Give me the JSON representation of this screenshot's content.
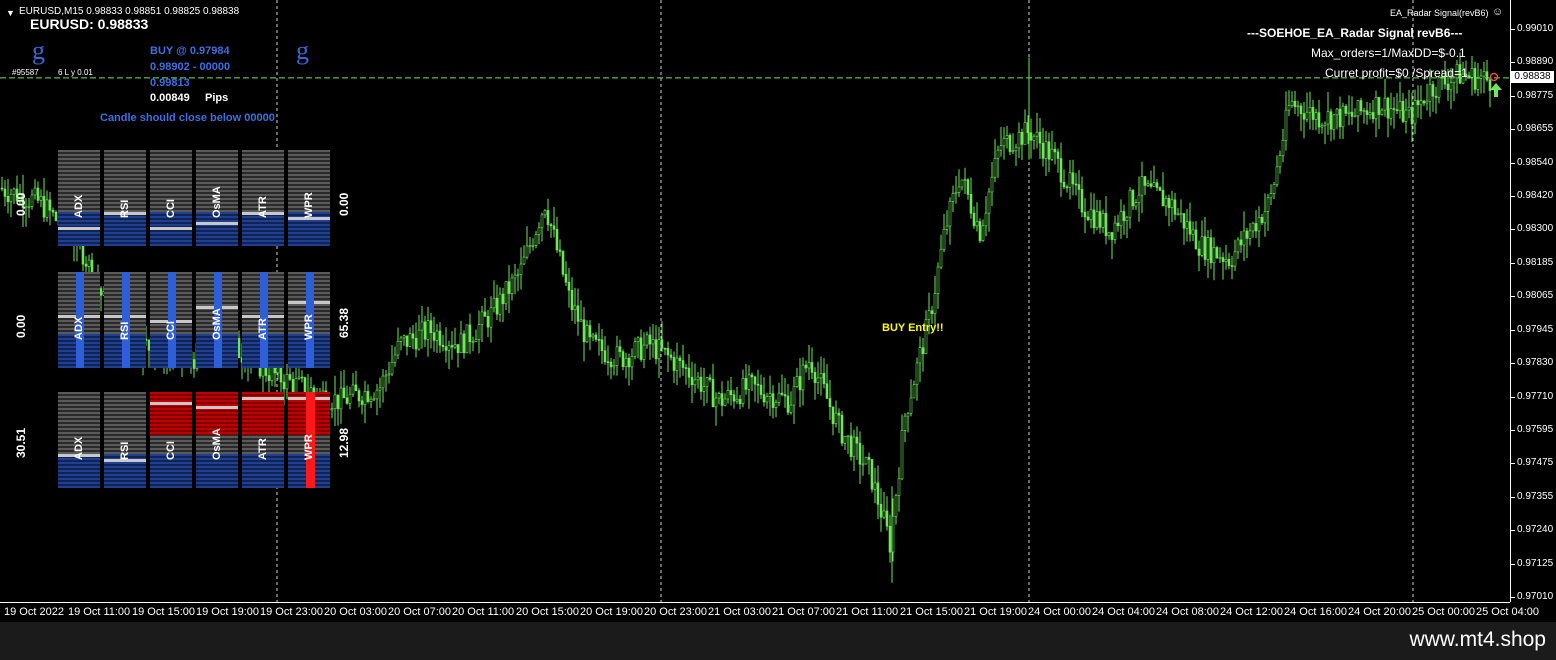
{
  "header": {
    "symbol_info": "EURUSD,M15  0.98833 0.98851 0.98825 0.98838",
    "symbol_price": "EURUSD: 0.98833",
    "indicator_name": "EA_Radar Signal(revB6)",
    "menu_icon": "triangle-down-icon",
    "indicator_icon": "smiley-icon"
  },
  "ea_info": {
    "title": "---SOEHOE_EA_Radar Signal revB6---",
    "max_orders": "Max_orders=1/MaxDD=$-0.1",
    "profit": "Curret profit=$0 /Spread=1"
  },
  "signal": {
    "buy_at": "BUY @ 0.97984",
    "range": "0.98902 - 00000",
    "level": "0.99813",
    "pips_value": "0.00849",
    "pips_label": "Pips",
    "candle_note": "Candle should close below 00000",
    "account_label": "#95587",
    "lot_label": "6 L  y 0.01",
    "buy_entry": "BUY Entry!!"
  },
  "logo_left": "g",
  "logo_right": "g",
  "indicator_panels": [
    {
      "left_value": "0.00",
      "right_value": "0.00",
      "labels": [
        "ADX",
        "RSI",
        "CCI",
        "OsMA",
        "ATR",
        "WPR"
      ],
      "levels": [
        0.2,
        0.35,
        0.2,
        0.25,
        0.35,
        0.3
      ],
      "theme": "grey"
    },
    {
      "left_value": "0.00",
      "right_value": "65.38",
      "labels": [
        "ADX",
        "RSI",
        "CCI",
        "OsMA",
        "ATR",
        "WPR"
      ],
      "levels": [
        0.55,
        0.55,
        0.5,
        0.65,
        0.55,
        0.7
      ],
      "theme": "blue"
    },
    {
      "left_value": "30.51",
      "right_value": "12.98",
      "labels": [
        "ADX",
        "RSI",
        "CCI",
        "OsMA",
        "ATR",
        "WPR"
      ],
      "levels": [
        0.35,
        0.3,
        0.9,
        0.85,
        0.95,
        0.95
      ],
      "theme": "red"
    }
  ],
  "price_axis": {
    "labels": [
      "0.99010",
      "0.98890",
      "0.98775",
      "0.98655",
      "0.98540",
      "0.98420",
      "0.98300",
      "0.98185",
      "0.98065",
      "0.97945",
      "0.97830",
      "0.97710",
      "0.97595",
      "0.97475",
      "0.97355",
      "0.97240",
      "0.97125",
      "0.97010"
    ],
    "current_price": "0.98838",
    "top_value": 0.9901,
    "bottom_value": 0.9701
  },
  "time_axis": {
    "labels": [
      "19 Oct 2022",
      "19 Oct 11:00",
      "19 Oct 15:00",
      "19 Oct 19:00",
      "19 Oct 23:00",
      "20 Oct 03:00",
      "20 Oct 07:00",
      "20 Oct 11:00",
      "20 Oct 15:00",
      "20 Oct 19:00",
      "20 Oct 23:00",
      "21 Oct 03:00",
      "21 Oct 07:00",
      "21 Oct 11:00",
      "21 Oct 15:00",
      "21 Oct 19:00",
      "24 Oct 00:00",
      "24 Oct 04:00",
      "24 Oct 08:00",
      "24 Oct 12:00",
      "24 Oct 16:00",
      "24 Oct 20:00",
      "25 Oct 00:00",
      "25 Oct 04:00"
    ]
  },
  "chart_data": {
    "type": "candlestick",
    "symbol": "EURUSD",
    "timeframe": "M15",
    "ylim": [
      0.9701,
      0.9901
    ],
    "current_price": 0.98838,
    "path": [
      [
        0,
        0.9845
      ],
      [
        40,
        0.984
      ],
      [
        80,
        0.9825
      ],
      [
        110,
        0.98
      ],
      [
        140,
        0.979
      ],
      [
        190,
        0.9785
      ],
      [
        230,
        0.979
      ],
      [
        270,
        0.978
      ],
      [
        300,
        0.9775
      ],
      [
        340,
        0.977
      ],
      [
        380,
        0.9775
      ],
      [
        400,
        0.979
      ],
      [
        430,
        0.9795
      ],
      [
        460,
        0.979
      ],
      [
        490,
        0.98
      ],
      [
        520,
        0.9815
      ],
      [
        545,
        0.984
      ],
      [
        570,
        0.9805
      ],
      [
        590,
        0.979
      ],
      [
        620,
        0.9785
      ],
      [
        650,
        0.979
      ],
      [
        690,
        0.978
      ],
      [
        720,
        0.977
      ],
      [
        750,
        0.9775
      ],
      [
        790,
        0.977
      ],
      [
        810,
        0.9785
      ],
      [
        840,
        0.976
      ],
      [
        870,
        0.9745
      ],
      [
        890,
        0.972
      ],
      [
        905,
        0.9765
      ],
      [
        930,
        0.98
      ],
      [
        945,
        0.983
      ],
      [
        960,
        0.985
      ],
      [
        980,
        0.983
      ],
      [
        1000,
        0.986
      ],
      [
        1030,
        0.9865
      ],
      [
        1055,
        0.9855
      ],
      [
        1080,
        0.984
      ],
      [
        1110,
        0.983
      ],
      [
        1140,
        0.9845
      ],
      [
        1170,
        0.984
      ],
      [
        1200,
        0.9825
      ],
      [
        1230,
        0.982
      ],
      [
        1250,
        0.983
      ],
      [
        1270,
        0.984
      ],
      [
        1290,
        0.9875
      ],
      [
        1320,
        0.987
      ],
      [
        1350,
        0.987
      ],
      [
        1380,
        0.9875
      ],
      [
        1410,
        0.987
      ],
      [
        1430,
        0.988
      ],
      [
        1460,
        0.9885
      ],
      [
        1490,
        0.9883
      ]
    ]
  },
  "colors": {
    "candle": "#6fe65a",
    "grid": "#cfcfcf",
    "current_line": "#6fe65a",
    "signal_blue": "#3d6fe0",
    "buy_entry": "#ffff00",
    "panel_red": "#d40000",
    "panel_blue": "#2e5fd8"
  }
}
